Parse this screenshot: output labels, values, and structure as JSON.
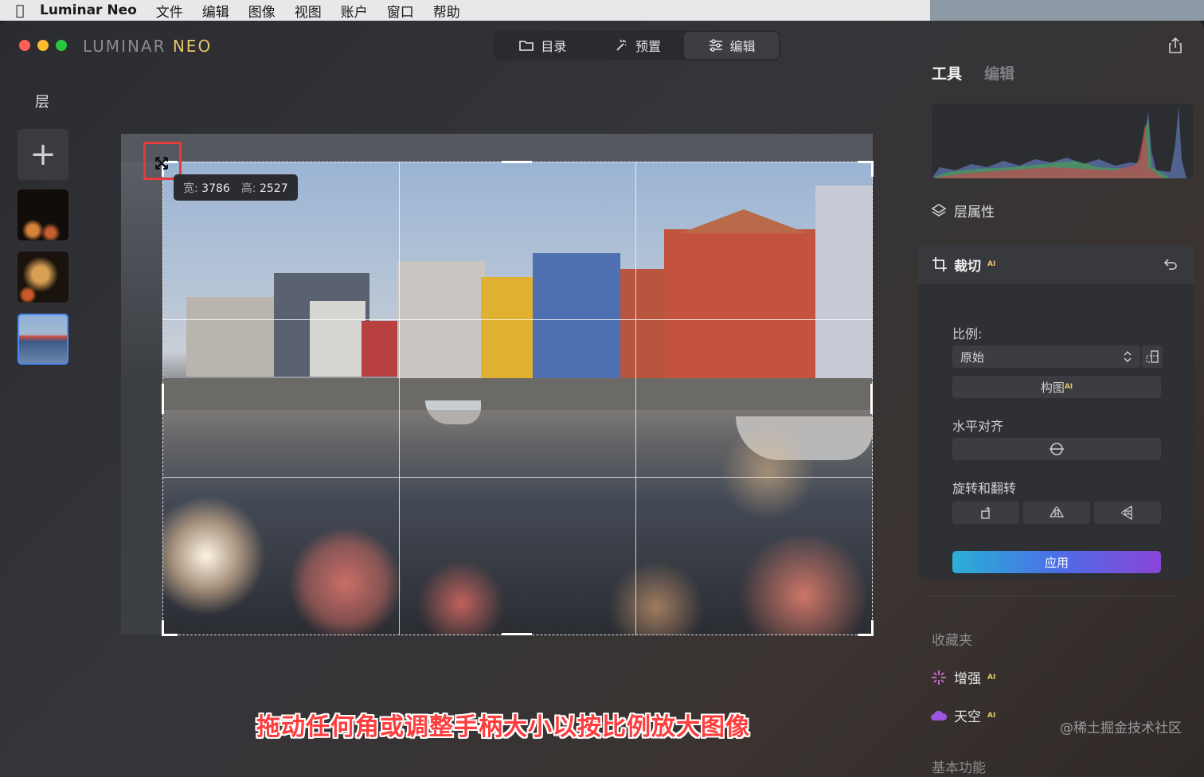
{
  "menubar": {
    "app_name": "Luminar Neo",
    "items": [
      "文件",
      "编辑",
      "图像",
      "视图",
      "账户",
      "窗口",
      "帮助"
    ]
  },
  "window": {
    "logo_part1": "LUMINAR ",
    "logo_part2": "NEO",
    "modes": [
      {
        "label": "目录",
        "icon": "folder-icon"
      },
      {
        "label": "预置",
        "icon": "magic-wand-icon"
      },
      {
        "label": "编辑",
        "icon": "sliders-icon",
        "active": true
      }
    ]
  },
  "layers": {
    "title": "层",
    "add_symbol": "+"
  },
  "canvas": {
    "tooltip": {
      "width_label": "宽:",
      "width_value": "3786",
      "height_label": "高:",
      "height_value": "2527"
    },
    "caption": "拖动任何角或调整手柄大小以按比例放大图像"
  },
  "right_panel": {
    "tabs": {
      "tools": "工具",
      "edit": "编辑"
    },
    "layer_properties": "层属性",
    "crop": {
      "title": "裁切",
      "ai_badge": "AI",
      "ratio_label": "比例:",
      "ratio_value": "原始",
      "composition_button": "构图",
      "horizon_label": "水平对齐",
      "rotate_flip_label": "旋转和翻转",
      "apply_button": "应用"
    },
    "favorites_title": "收藏夹",
    "favorites": [
      {
        "label": "增强",
        "ai": "AI",
        "icon": "sparkle-icon"
      },
      {
        "label": "天空",
        "ai": "AI",
        "icon": "cloud-icon"
      }
    ],
    "basic_title": "基本功能"
  },
  "watermark": "@稀土掘金技术社区",
  "colors": {
    "accent_blue": "#4b8bf0",
    "highlight_red": "#e23c3c",
    "apply_gradient_start": "#2ab0d6",
    "apply_gradient_end": "#8a45d8"
  }
}
